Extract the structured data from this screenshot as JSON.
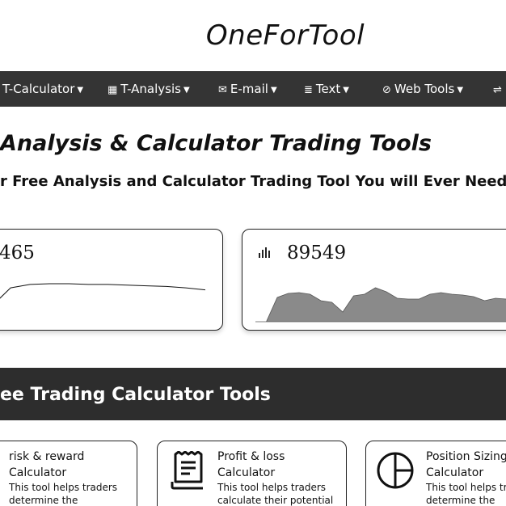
{
  "brand": "OneForTool",
  "nav": [
    {
      "icon": "calculator-icon",
      "label": "T-Calculator",
      "glyph": ""
    },
    {
      "icon": "bar-chart-icon",
      "label": "T-Analysis",
      "glyph": "▦"
    },
    {
      "icon": "envelope-icon",
      "label": "E-mail",
      "glyph": "✉"
    },
    {
      "icon": "text-lines-icon",
      "label": "Text",
      "glyph": "≣"
    },
    {
      "icon": "link-icon",
      "label": "Web Tools",
      "glyph": "⊘"
    },
    {
      "icon": "exchange-icon",
      "label": "",
      "glyph": "⇌"
    }
  ],
  "hero": {
    "title": "Analysis & Calculator Trading Tools",
    "subtitle": "r Free Analysis and Calculator Trading Tool You will Ever Need!"
  },
  "stats": [
    {
      "value": "465",
      "icon": "",
      "series": [
        10,
        38,
        43,
        44,
        44,
        43,
        43,
        42,
        41,
        40,
        38,
        35
      ]
    },
    {
      "value": "89549",
      "icon": "bar-chart-icon",
      "series": [
        0,
        0,
        30,
        35,
        36,
        34,
        26,
        24,
        12,
        32,
        34,
        42,
        37,
        29,
        28,
        28,
        34,
        36,
        34,
        33,
        31,
        26,
        29,
        28,
        27
      ]
    }
  ],
  "section": {
    "title": "ee Trading Calculator Tools"
  },
  "tools": [
    {
      "icon": "",
      "title": "risk & reward Calculator",
      "description": "This tool helps traders determine the"
    },
    {
      "icon": "receipt-icon",
      "title": "Profit & loss Calculator",
      "description": "This tool helps traders calculate their potential"
    },
    {
      "icon": "pie-chart-icon",
      "title": "Position Sizing Calculator",
      "description": "This tool helps tr determine the"
    }
  ]
}
